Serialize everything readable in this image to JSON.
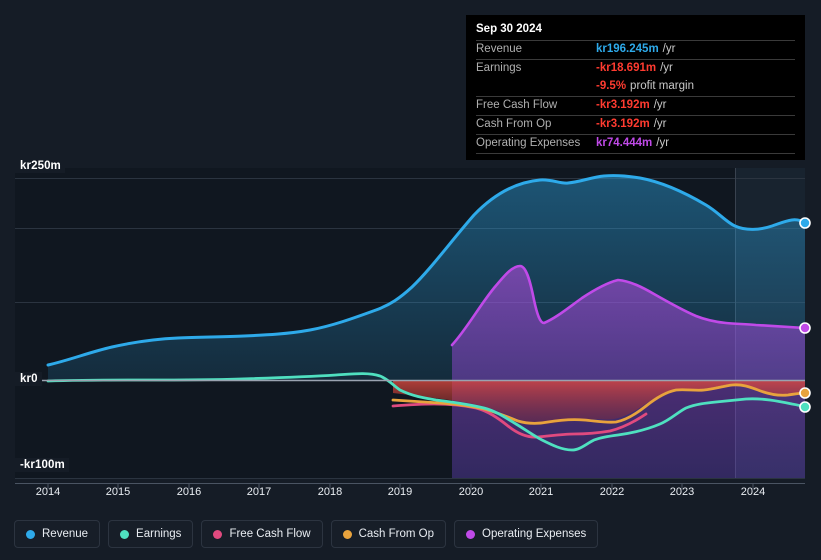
{
  "colors": {
    "background": "#151c26",
    "plot_background": "#101720",
    "forecast_background": "#16202c",
    "gridline": "#2b3440",
    "revenue": "#2eaaea",
    "earnings": "#4fe0c0",
    "free_cash_flow": "#e04a7f",
    "cash_from_op": "#e8a33d",
    "operating_expenses": "#c04ae8",
    "tooltip_background": "#000000",
    "tooltip_positive": "#2eaaea",
    "tooltip_negative": "#ff3b30",
    "tooltip_opex": "#c04ae8"
  },
  "tooltip": {
    "title": "Sep 30 2024",
    "rows": [
      {
        "label": "Revenue",
        "value": "kr196.245m",
        "suffix": "/yr",
        "value_color": "#2eaaea"
      },
      {
        "label": "Earnings",
        "value": "-kr18.691m",
        "suffix": "/yr",
        "value_color": "#ff3b30"
      },
      {
        "label": "",
        "value": "-9.5%",
        "suffix": "profit margin",
        "value_color": "#ff3b30"
      },
      {
        "label": "Free Cash Flow",
        "value": "-kr3.192m",
        "suffix": "/yr",
        "value_color": "#ff3b30"
      },
      {
        "label": "Cash From Op",
        "value": "-kr3.192m",
        "suffix": "/yr",
        "value_color": "#ff3b30"
      },
      {
        "label": "Operating Expenses",
        "value": "kr74.444m",
        "suffix": "/yr",
        "value_color": "#c04ae8"
      }
    ]
  },
  "yaxis": {
    "top_label": "kr250m",
    "zero_label": "kr0",
    "bottom_label": "-kr100m"
  },
  "legend": {
    "items": [
      {
        "label": "Revenue",
        "color": "#2eaaea"
      },
      {
        "label": "Earnings",
        "color": "#4fe0c0"
      },
      {
        "label": "Free Cash Flow",
        "color": "#e04a7f"
      },
      {
        "label": "Cash From Op",
        "color": "#e8a33d"
      },
      {
        "label": "Operating Expenses",
        "color": "#c04ae8"
      }
    ]
  },
  "chart_data": {
    "type": "area",
    "title": "",
    "xlabel": "",
    "ylabel": "",
    "currency": "kr",
    "units": "millions",
    "grid": true,
    "legend_position": "bottom",
    "ylim": [
      -100,
      250
    ],
    "yticks": [
      -100,
      0,
      250
    ],
    "ytick_labels": [
      "-kr100m",
      "kr0",
      "kr250m"
    ],
    "xlim": [
      "2013-09",
      "2024-12"
    ],
    "xticks": [
      "2014",
      "2015",
      "2016",
      "2017",
      "2018",
      "2019",
      "2020",
      "2021",
      "2022",
      "2023",
      "2024"
    ],
    "annotations": {
      "forecast_boundary": "2023-06",
      "endpoint_markers": true
    },
    "series": [
      {
        "name": "Revenue",
        "color": "#2eaaea",
        "x": [
          "2013-09",
          "2014-03",
          "2014-09",
          "2015-03",
          "2015-09",
          "2016-03",
          "2016-09",
          "2017-03",
          "2017-09",
          "2018-03",
          "2018-09",
          "2019-03",
          "2019-09",
          "2020-03",
          "2020-09",
          "2021-03",
          "2021-09",
          "2022-03",
          "2022-09",
          "2023-03",
          "2023-09",
          "2024-03",
          "2024-09"
        ],
        "values": [
          18,
          26,
          36,
          43,
          45,
          45,
          46,
          47,
          50,
          57,
          70,
          76,
          78,
          110,
          168,
          207,
          230,
          237,
          249,
          244,
          222,
          188,
          196.245
        ]
      },
      {
        "name": "Earnings",
        "color": "#4fe0c0",
        "x": [
          "2013-09",
          "2014-03",
          "2014-09",
          "2015-03",
          "2015-09",
          "2016-03",
          "2016-09",
          "2017-03",
          "2017-09",
          "2018-03",
          "2018-09",
          "2019-03",
          "2019-09",
          "2020-03",
          "2020-09",
          "2021-03",
          "2021-09",
          "2022-03",
          "2022-09",
          "2023-03",
          "2023-09",
          "2024-03",
          "2024-09"
        ],
        "values": [
          0.5,
          1,
          1,
          1,
          1,
          1,
          1.5,
          2,
          3,
          3.5,
          5,
          4,
          -5,
          -10,
          -12,
          -30,
          -42,
          -70,
          -56,
          -38,
          -30,
          -24,
          -18.691
        ]
      },
      {
        "name": "Free Cash Flow",
        "color": "#e04a7f",
        "x": [
          "2019-03",
          "2019-09",
          "2020-03",
          "2020-09",
          "2021-03",
          "2021-09",
          "2022-03",
          "2022-09"
        ],
        "values": [
          -8,
          -10,
          -10,
          -12,
          -30,
          -34,
          -34,
          -30
        ]
      },
      {
        "name": "Cash From Op",
        "color": "#e8a33d",
        "x": [
          "2019-03",
          "2019-09",
          "2020-03",
          "2020-09",
          "2021-03",
          "2021-09",
          "2022-03",
          "2022-09",
          "2023-03",
          "2023-09",
          "2024-03",
          "2024-09"
        ],
        "values": [
          -5,
          -7,
          -8,
          -9,
          -22,
          -19,
          -22,
          -26,
          -4,
          3,
          -8,
          -3.192
        ]
      },
      {
        "name": "Operating Expenses",
        "color": "#c04ae8",
        "x": [
          "2019-09",
          "2020-03",
          "2020-09",
          "2021-03",
          "2021-09",
          "2022-03",
          "2022-09",
          "2023-03",
          "2023-09",
          "2024-03",
          "2024-09"
        ],
        "values": [
          18,
          55,
          96,
          57,
          70,
          105,
          95,
          82,
          74,
          76,
          74.444
        ]
      }
    ]
  }
}
